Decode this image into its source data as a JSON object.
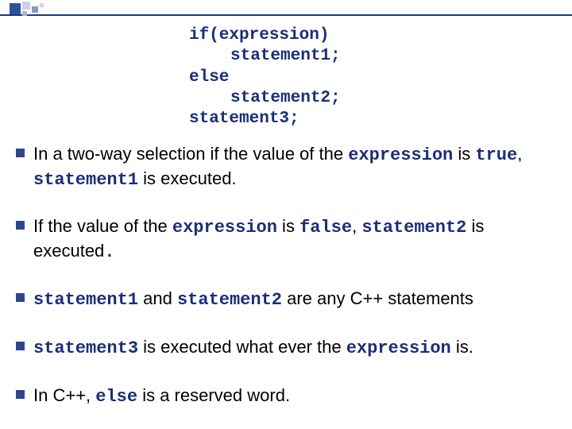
{
  "code": {
    "l1": "if(expression)",
    "l2": "statement1;",
    "l3": "else",
    "l4": "statement2;",
    "l5": "statement3;"
  },
  "bullets": {
    "b1": {
      "p1": "In a two-way selection if the value of the ",
      "c1": "expression",
      "p2": " is ",
      "c2": "true",
      "p3": ", ",
      "c3": "statement1",
      "p4": " is executed."
    },
    "b2": {
      "p1": "If the value of the ",
      "c1": "expression",
      "p2": " is ",
      "c2": "false",
      "p3": ", ",
      "c3": "statement2",
      "p4": " is  executed",
      "c4": "."
    },
    "b3": {
      "c1": "statement1",
      "p1": " and ",
      "c2": "statement2",
      "p2": " are any C++ statements"
    },
    "b4": {
      "c1": "statement3",
      "p1": " is executed what ever the ",
      "c2": "expression",
      "p2": " is."
    },
    "b5": {
      "p1": "In C++, ",
      "c1": "else",
      "p2": " is a reserved word."
    }
  }
}
